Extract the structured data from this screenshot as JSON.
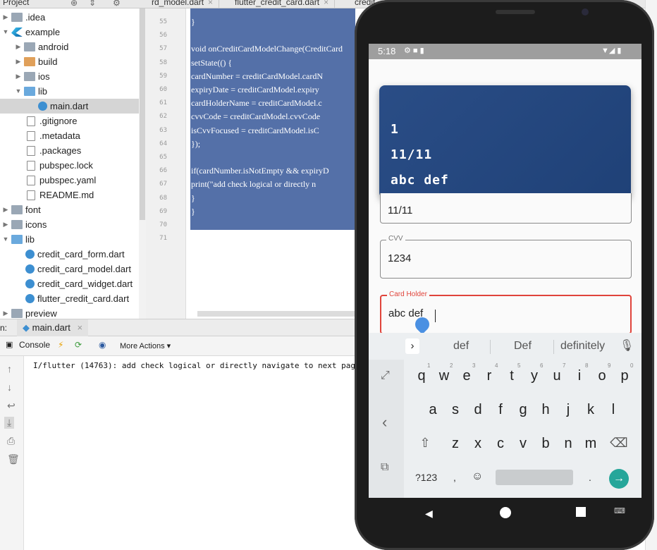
{
  "ide": {
    "project_label": "Project",
    "editor_tabs": [
      "rd_model.dart",
      "flutter_credit_card.dart",
      "credit"
    ],
    "tree": [
      {
        "label": ".idea",
        "icon": "folder-icon",
        "arrow": "▶"
      },
      {
        "label": "example",
        "icon": "flutter-icon",
        "arrow": "▼"
      },
      {
        "label": "android",
        "icon": "folder-icon",
        "arrow": "▶"
      },
      {
        "label": "build",
        "icon": "folder-icon",
        "arrow": "▶"
      },
      {
        "label": "ios",
        "icon": "folder-icon",
        "arrow": "▶"
      },
      {
        "label": "lib",
        "icon": "folder-icon",
        "arrow": "▼"
      },
      {
        "label": "main.dart",
        "icon": "dart-file-icon",
        "arrow": ""
      },
      {
        "label": ".gitignore",
        "icon": "file-icon",
        "arrow": ""
      },
      {
        "label": ".metadata",
        "icon": "file-icon",
        "arrow": ""
      },
      {
        "label": ".packages",
        "icon": "file-icon",
        "arrow": ""
      },
      {
        "label": "pubspec.lock",
        "icon": "file-icon",
        "arrow": ""
      },
      {
        "label": "pubspec.yaml",
        "icon": "file-icon",
        "arrow": ""
      },
      {
        "label": "README.md",
        "icon": "file-icon",
        "arrow": ""
      },
      {
        "label": "font",
        "icon": "folder-icon",
        "arrow": "▶"
      },
      {
        "label": "icons",
        "icon": "folder-icon",
        "arrow": "▶"
      },
      {
        "label": "lib",
        "icon": "folder-icon",
        "arrow": "▼"
      },
      {
        "label": "credit_card_form.dart",
        "icon": "dart-file-icon",
        "arrow": ""
      },
      {
        "label": "credit_card_model.dart",
        "icon": "dart-file-icon",
        "arrow": ""
      },
      {
        "label": "credit_card_widget.dart",
        "icon": "dart-file-icon",
        "arrow": ""
      },
      {
        "label": "flutter_credit_card.dart",
        "icon": "dart-file-icon",
        "arrow": ""
      },
      {
        "label": "preview",
        "icon": "folder-icon",
        "arrow": "▶"
      }
    ],
    "line_numbers": [
      "55",
      "56",
      "57",
      "58",
      "59",
      "60",
      "61",
      "62",
      "63",
      "64",
      "65",
      "66",
      "67",
      "68",
      "69",
      "70",
      "71"
    ],
    "code_lines": [
      "}",
      "",
      "void onCreditCardModelChange(CreditCard",
      "  setState(() {",
      "    cardNumber = creditCardModel.cardN",
      "    expiryDate = creditCardModel.expiry",
      "    cardHolderName = creditCardModel.c",
      "    cvvCode = creditCardModel.cvvCode",
      "    isCvvFocused = creditCardModel.isC",
      "  });",
      "",
      "  if(cardNumber.isNotEmpty && expiryD",
      "    print(\"add check logical or directly n",
      "  }",
      "}",
      "",
      ""
    ],
    "run_label": "n:",
    "run_tab": "main.dart",
    "console_tab": "Console",
    "more_actions": "More Actions",
    "console_output": "I/flutter (14763): add check logical or directly  navigate to next page"
  },
  "phone": {
    "time": "5:18",
    "card": {
      "number": "1",
      "expiry": "11/11",
      "holder": "abc def"
    },
    "fields": {
      "expiry_value": "11/11",
      "cvv_label": "CVV",
      "cvv_value": "1234",
      "holder_label": "Card Holder",
      "holder_value": "abc def"
    },
    "keyboard": {
      "suggestions": [
        "def",
        "Def",
        "definitely"
      ],
      "row1": [
        "q",
        "w",
        "e",
        "r",
        "t",
        "y",
        "u",
        "i",
        "o",
        "p"
      ],
      "row1_hints": [
        "1",
        "2",
        "3",
        "4",
        "5",
        "6",
        "7",
        "8",
        "9",
        "0"
      ],
      "row2": [
        "a",
        "s",
        "d",
        "f",
        "g",
        "h",
        "j",
        "k",
        "l"
      ],
      "row3": [
        "z",
        "x",
        "c",
        "v",
        "b",
        "n",
        "m"
      ],
      "symbols_key": "?123",
      "comma": ",",
      "period": "."
    },
    "colors": {
      "card": "#2a4d86",
      "error": "#e0443b",
      "enter": "#26a69a"
    }
  }
}
